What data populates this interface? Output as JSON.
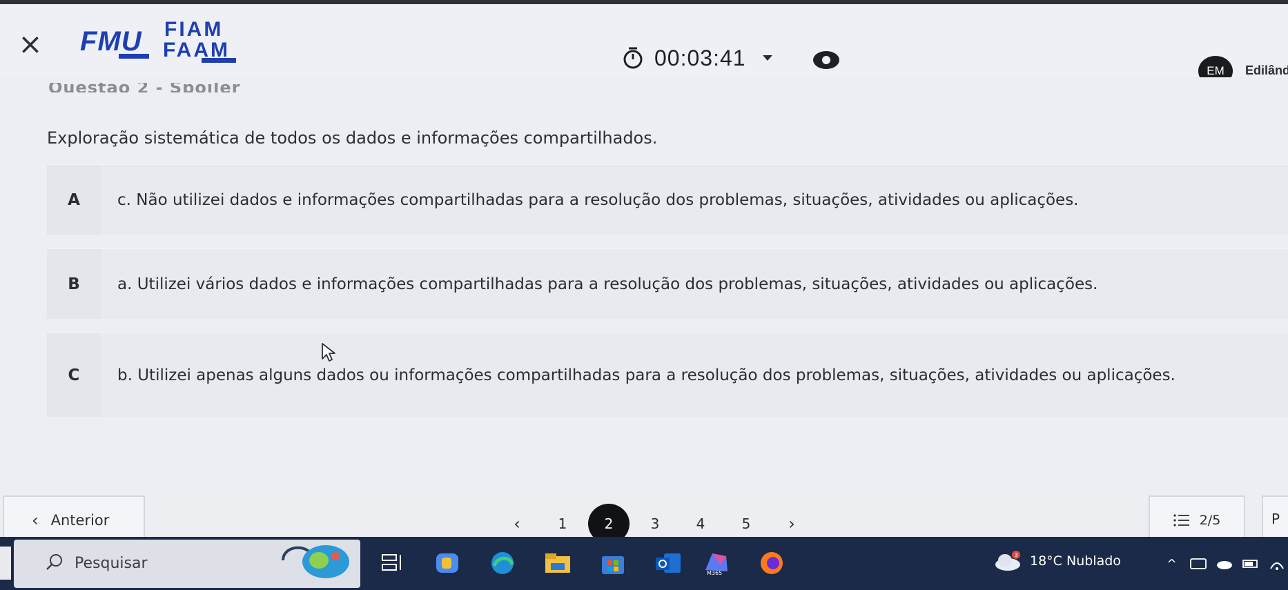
{
  "header": {
    "close_glyph": "×",
    "logo": {
      "fmu": "FMU",
      "fiam": "FIAM",
      "faam": "FAAM"
    },
    "timer": "00:03:41",
    "user": {
      "initials": "EM",
      "name": "Edilândi"
    }
  },
  "question": {
    "label_cut": "Questão 2 - Spoiler",
    "text": "Exploração sistemática de todos os dados e informações compartilhados."
  },
  "options": [
    {
      "letter": "A",
      "text": "c. Não utilizei dados e informações compartilhadas para a resolução dos problemas,  situações, atividades ou aplicações."
    },
    {
      "letter": "B",
      "text": "a. Utilizei vários dados e informações compartilhadas para a resolução dos problemas, situações, atividades ou aplicações."
    },
    {
      "letter": "C",
      "text": "b. Utilizei apenas alguns dados ou informações compartilhadas para a resolução dos problemas, situações, atividades ou aplicações."
    }
  ],
  "navigation": {
    "prev_label": "Anterior",
    "pages": [
      "1",
      "2",
      "3",
      "4",
      "5"
    ],
    "active_page": "2",
    "progress": "2/5",
    "next_cut": "P"
  },
  "taskbar": {
    "search_placeholder": "Pesquisar",
    "weather": "18°C  Nublado",
    "weather_badge": "3"
  },
  "colors": {
    "brand": "#1f3fb0",
    "active_page_bg": "#111215",
    "taskbar_bg": "#1c2a4a"
  }
}
